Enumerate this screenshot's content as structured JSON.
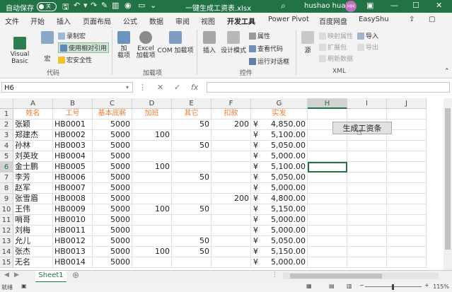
{
  "titlebar": {
    "autosave": "自动保存",
    "autosave_state": "关",
    "doc_title": "一键生成工资表.xlsx",
    "user_name": "hushao huali",
    "avatar": "HH"
  },
  "tabs": [
    "文件",
    "开始",
    "插入",
    "页面布局",
    "公式",
    "数据",
    "审阅",
    "视图",
    "开发工具",
    "Power Pivot",
    "百度网盘",
    "EasyShu"
  ],
  "active_tab": "开发工具",
  "ribbon": {
    "visual_basic": "Visual Basic",
    "macro": "宏",
    "record_macro": "录制宏",
    "relative_ref": "使用相对引用",
    "macro_security": "宏安全性",
    "group_code": "代码",
    "addins": "加\n载项",
    "excel_addins": "Excel\n加载项",
    "com_addins": "COM 加载项",
    "group_addins": "加载项",
    "insert": "插入",
    "design_mode": "设计模式",
    "properties": "属性",
    "view_code": "查看代码",
    "run_dialog": "运行对话框",
    "group_controls": "控件",
    "source": "源",
    "map_props": "映射属性",
    "expansion_pack": "扩展包",
    "refresh_data": "刷新数据",
    "import": "导入",
    "export": "导出",
    "group_xml": "XML"
  },
  "formula_bar": {
    "namebox": "H6",
    "fx": "fx"
  },
  "columns": [
    "A",
    "B",
    "C",
    "D",
    "E",
    "F",
    "G",
    "H",
    "I",
    "J"
  ],
  "rows": [
    "1",
    "2",
    "3",
    "4",
    "5",
    "6",
    "7",
    "8",
    "9",
    "10",
    "11",
    "12",
    "13",
    "14",
    "15"
  ],
  "headers": [
    "姓名",
    "工号",
    "基本底薪",
    "加班",
    "其它",
    "扣款",
    "实发"
  ],
  "table": [
    {
      "name": "张颖",
      "id": "HB0001",
      "base": "5000",
      "ot": "",
      "other": "50",
      "deduct": "200",
      "pay": "4,850.00"
    },
    {
      "name": "郑建杰",
      "id": "HB0002",
      "base": "5000",
      "ot": "100",
      "other": "",
      "deduct": "",
      "pay": "5,100.00"
    },
    {
      "name": "孙林",
      "id": "HB0003",
      "base": "5000",
      "ot": "",
      "other": "50",
      "deduct": "",
      "pay": "5,050.00"
    },
    {
      "name": "刘英玫",
      "id": "HB0004",
      "base": "5000",
      "ot": "",
      "other": "",
      "deduct": "",
      "pay": "5,000.00"
    },
    {
      "name": "金士鹏",
      "id": "HB0005",
      "base": "5000",
      "ot": "100",
      "other": "",
      "deduct": "",
      "pay": "5,100.00"
    },
    {
      "name": "李芳",
      "id": "HB0006",
      "base": "5000",
      "ot": "",
      "other": "50",
      "deduct": "",
      "pay": "5,050.00"
    },
    {
      "name": "赵军",
      "id": "HB0007",
      "base": "5000",
      "ot": "",
      "other": "",
      "deduct": "",
      "pay": "5,000.00"
    },
    {
      "name": "张雪眉",
      "id": "HB0008",
      "base": "5000",
      "ot": "",
      "other": "",
      "deduct": "200",
      "pay": "4,800.00"
    },
    {
      "name": "王伟",
      "id": "HB0009",
      "base": "5000",
      "ot": "100",
      "other": "50",
      "deduct": "",
      "pay": "5,150.00"
    },
    {
      "name": "哨哥",
      "id": "HB0010",
      "base": "5000",
      "ot": "",
      "other": "",
      "deduct": "",
      "pay": "5,000.00"
    },
    {
      "name": "刘梅",
      "id": "HB0011",
      "base": "5000",
      "ot": "",
      "other": "",
      "deduct": "",
      "pay": "5,000.00"
    },
    {
      "name": "允儿",
      "id": "HB0012",
      "base": "5000",
      "ot": "",
      "other": "50",
      "deduct": "",
      "pay": "5,050.00"
    },
    {
      "name": "张杰",
      "id": "HB0013",
      "base": "5000",
      "ot": "100",
      "other": "50",
      "deduct": "",
      "pay": "5,150.00"
    },
    {
      "name": "无名",
      "id": "HB0014",
      "base": "5000",
      "ot": "",
      "other": "",
      "deduct": "",
      "pay": "5,000.00"
    }
  ],
  "currency": "¥",
  "button_label": "生成工资条",
  "sheet_tab": "Sheet1",
  "status": {
    "ready": "就绪",
    "zoom": "115%"
  },
  "colors": {
    "accent": "#217346",
    "header_text": "#ed7d31"
  }
}
